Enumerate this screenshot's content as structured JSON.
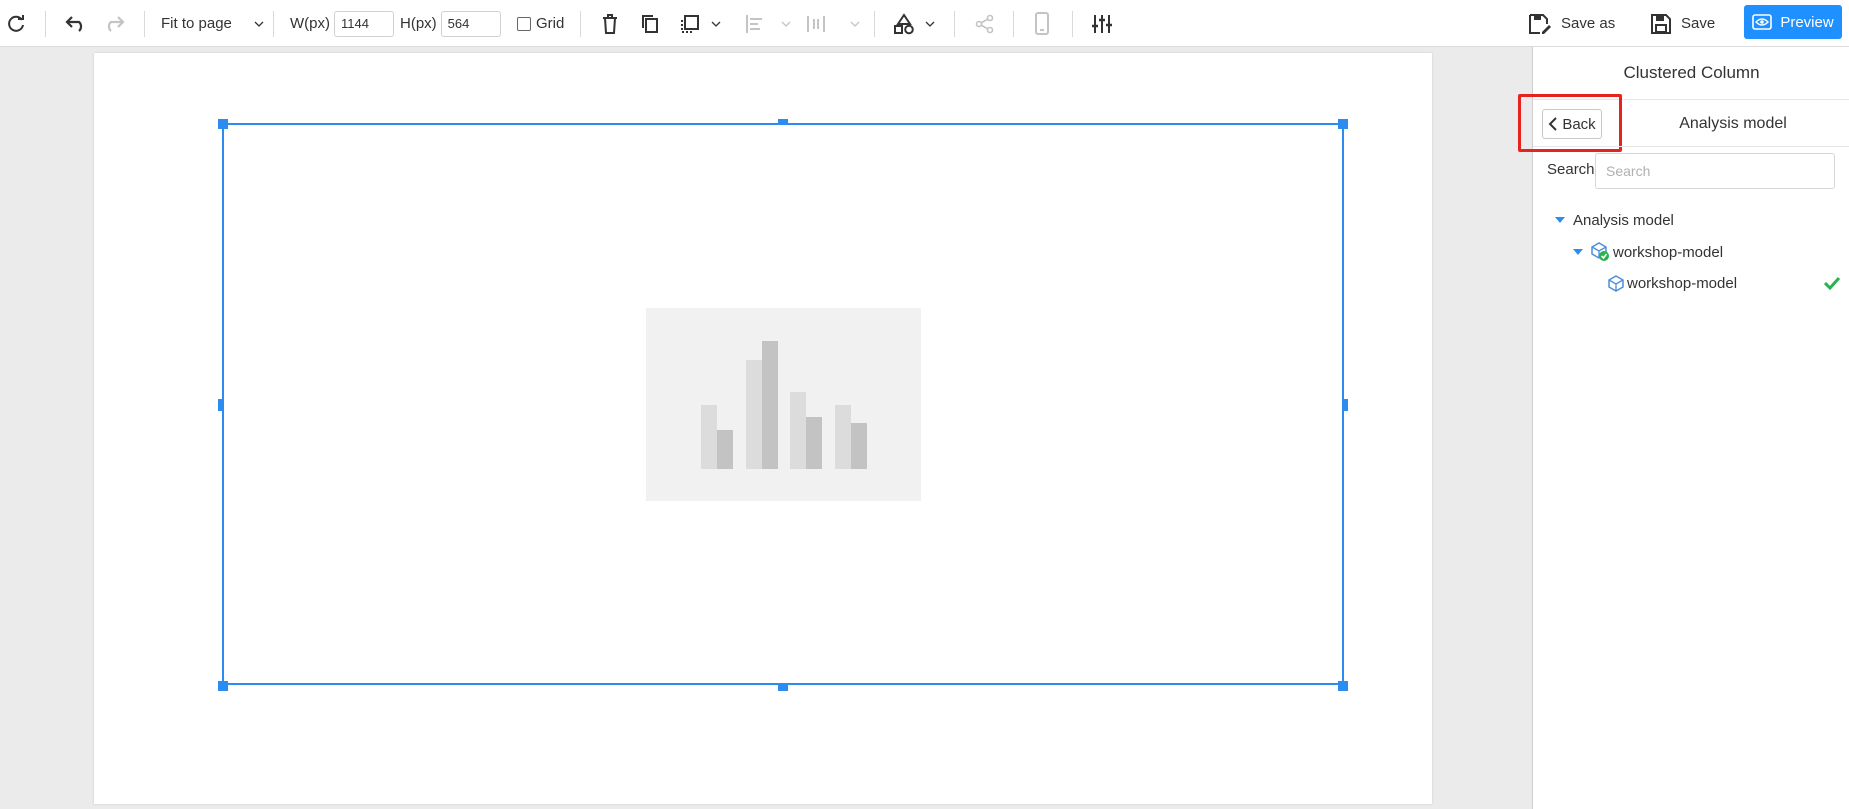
{
  "toolbar": {
    "zoom_select": "Fit to page",
    "width_label": "W(px)",
    "width_value": "1144",
    "height_label": "H(px)",
    "height_value": "564",
    "grid_label": "Grid",
    "save_as_label": "Save as",
    "save_label": "Save",
    "preview_label": "Preview"
  },
  "panel": {
    "title": "Clustered Column",
    "back_label": "Back",
    "section_title": "Analysis model",
    "search_label": "Search",
    "search_placeholder": "Search",
    "tree": {
      "root_label": "Analysis model",
      "child_label": "workshop-model",
      "leaf_label": "workshop-model"
    }
  },
  "colors": {
    "accent": "#1e90ff",
    "selection": "#2d8cf0",
    "highlight": "#e8231f",
    "check": "#2bb24c"
  }
}
